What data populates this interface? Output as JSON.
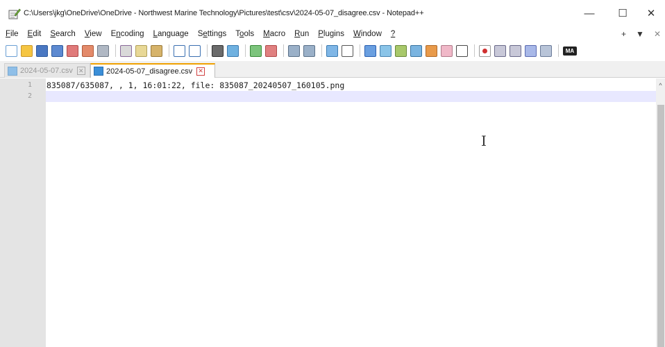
{
  "window": {
    "title": "C:\\Users\\jkg\\OneDrive\\OneDrive - Northwest Marine Technology\\Pictures\\test\\csv\\2024-05-07_disagree.csv - Notepad++",
    "minimize_glyph": "—",
    "maximize_glyph": "☐",
    "close_glyph": "✕"
  },
  "menu": {
    "items": [
      {
        "label": "File"
      },
      {
        "label": "Edit"
      },
      {
        "label": "Search"
      },
      {
        "label": "View"
      },
      {
        "label": "Encoding"
      },
      {
        "label": "Language"
      },
      {
        "label": "Settings"
      },
      {
        "label": "Tools"
      },
      {
        "label": "Macro"
      },
      {
        "label": "Run"
      },
      {
        "label": "Plugins"
      },
      {
        "label": "Window"
      },
      {
        "label": "?"
      }
    ],
    "right": {
      "plus": "+",
      "down": "▼",
      "close": "✕"
    }
  },
  "toolbar": {
    "icons": [
      "new-file-icon",
      "open-file-icon",
      "save-icon",
      "save-all-icon",
      "close-icon",
      "close-all-icon",
      "print-icon",
      "cut-icon",
      "copy-icon",
      "paste-icon",
      "undo-icon",
      "redo-icon",
      "find-icon",
      "replace-icon",
      "zoom-in-icon",
      "zoom-out-icon",
      "sync-vertical-icon",
      "sync-horizontal-icon",
      "word-wrap-icon",
      "show-all-chars-icon",
      "indent-guide-icon",
      "document-map-icon",
      "function-list-icon",
      "folder-workspace-icon",
      "monitoring-icon",
      "doc-list-icon",
      "eye-icon",
      "record-macro-icon",
      "stop-record-icon",
      "play-macro-icon",
      "run-macro-multiple-icon",
      "save-macro-icon",
      "markdown-icon"
    ],
    "markdown_label": "MA"
  },
  "tabs": [
    {
      "label": "2024-05-07.csv",
      "active": false
    },
    {
      "label": "2024-05-07_disagree.csv",
      "active": true
    }
  ],
  "editor": {
    "lines": [
      {
        "number": "1",
        "text": "835087/635087, , 1, 16:01:22, file: 835087_20240507_160105.png"
      },
      {
        "number": "2",
        "text": ""
      }
    ],
    "cursor_glyph": "I",
    "current_line_color": "#e8e8ff"
  },
  "scrollbar": {
    "up_arrow": "^"
  }
}
